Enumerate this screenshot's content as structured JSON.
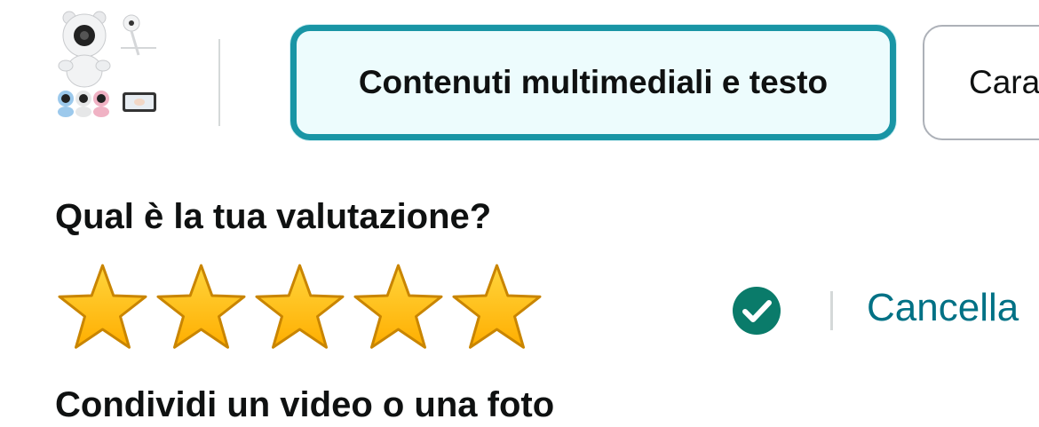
{
  "product": {
    "thumbnail_icon": "baby-monitor-camera-product-image"
  },
  "tabs": [
    {
      "label": "Contenuti multimediali e testo",
      "active": true
    },
    {
      "label": "Caratteristiche",
      "active": false
    }
  ],
  "rating": {
    "question": "Qual è la tua valutazione?",
    "value": 5,
    "max": 5,
    "confirmed_icon": "check-circle-icon",
    "clear_label": "Cancella"
  },
  "media": {
    "heading": "Condividi un video o una foto"
  },
  "colors": {
    "accent": "#1995a5",
    "tab_bg": "#edfcfd",
    "star_fill": "#ffc500",
    "star_stroke": "#c98500",
    "link": "#007185",
    "check": "#0a7b6a"
  }
}
